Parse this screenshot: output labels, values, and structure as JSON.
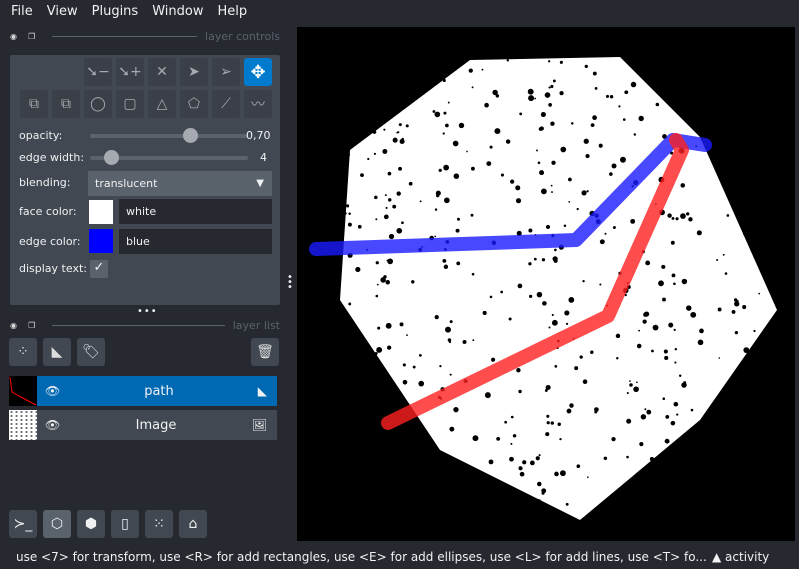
{
  "menu": [
    "File",
    "View",
    "Plugins",
    "Window",
    "Help"
  ],
  "layer_controls": {
    "title": "layer controls",
    "mode_buttons": [
      "remove-vertex",
      "add-vertex",
      "delete-shape",
      "select-shape",
      "direct-select",
      "pan-zoom",
      "move-back",
      "move-front",
      "ellipse",
      "rectangle",
      "polygon",
      "lasso-polygon",
      "line",
      "path"
    ],
    "active_mode": "pan-zoom",
    "opacity_label": "opacity:",
    "opacity_value": "0,70",
    "opacity": 0.7,
    "edge_width_label": "edge width:",
    "edge_width_value": "4",
    "blending_label": "blending:",
    "blending_value": "translucent",
    "face_color_label": "face color:",
    "face_color_value": "white",
    "face_color": "#ffffff",
    "edge_color_label": "edge color:",
    "edge_color_value": "blue",
    "edge_color": "#0000ff",
    "display_text_label": "display text:",
    "display_text_checked": true
  },
  "layer_list": {
    "title": "layer list",
    "layers": [
      {
        "name": "path",
        "selected": true,
        "type": "shapes"
      },
      {
        "name": "Image",
        "selected": false,
        "type": "image"
      }
    ]
  },
  "status": {
    "message": "use <7> for transform, use <R> for add rectangles, use <E> for add ellipses, use <L> for add lines, use <T> fo...",
    "activity": "▲ activity"
  },
  "colors": {
    "accent": "#007acc",
    "blue_path": "#1a1aff",
    "red_path": "#ff2020"
  }
}
